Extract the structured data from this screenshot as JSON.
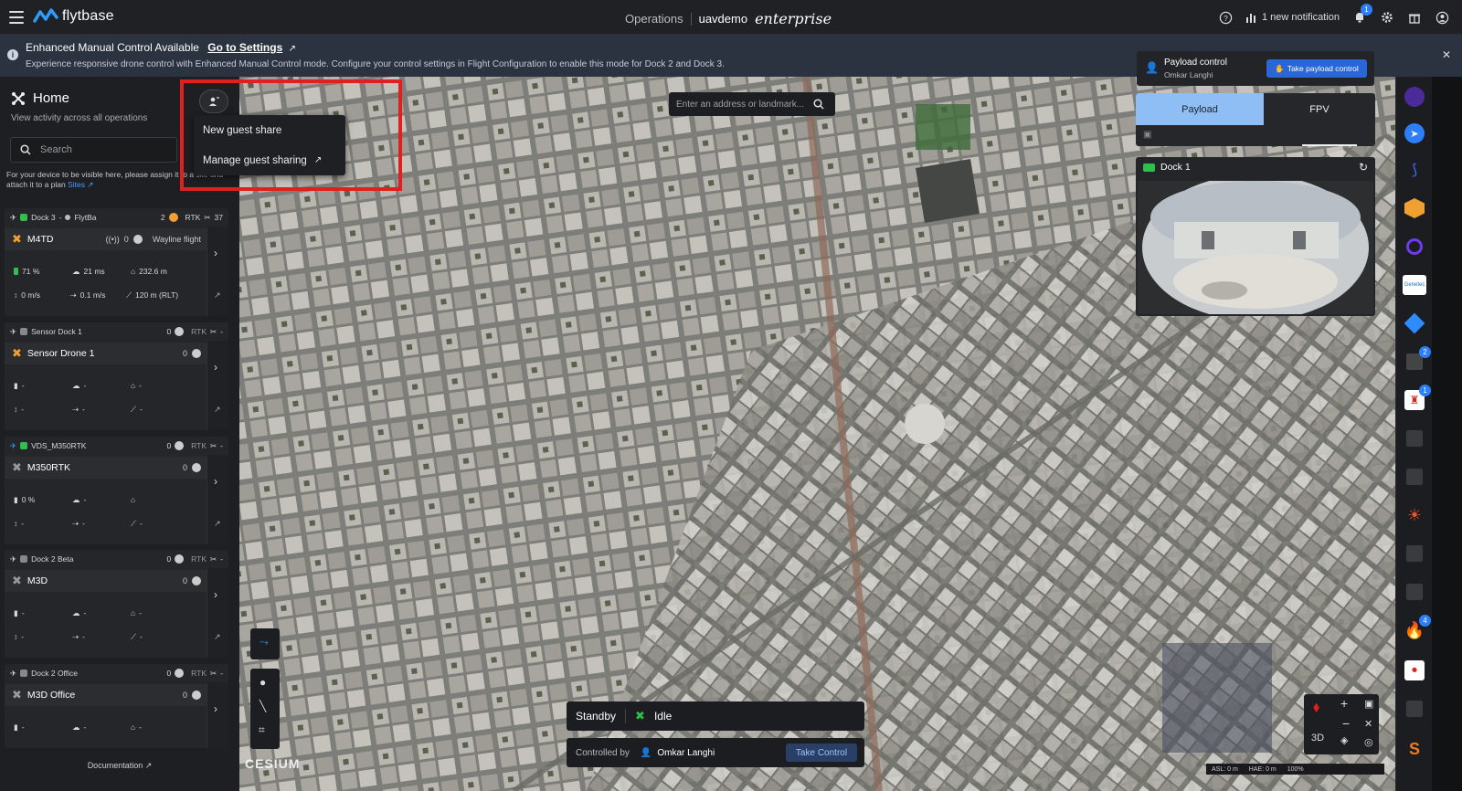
{
  "topbar": {
    "logo_text": "flytbase",
    "nav_operations": "Operations",
    "org_name": "uavdemo",
    "edition": "enterprise",
    "notification_text": "1 new notification",
    "notification_count": "1"
  },
  "banner": {
    "title": "Enhanced Manual Control Available",
    "link": "Go to Settings",
    "text": "Experience responsive drone control with Enhanced Manual Control mode. Configure your control settings in Flight Configuration to enable this mode for Dock 2 and Dock 3."
  },
  "sidebar": {
    "title": "Home",
    "subtitle": "View activity across all operations",
    "search_placeholder": "Search",
    "note_text": "For your device to be visible here, please assign it to a site and attach it to a plan",
    "note_link": "Sites",
    "documentation": "Documentation",
    "cards": [
      {
        "dock": "Dock 3",
        "dock_sub": "FlytBa",
        "count": "2",
        "rtk": "RTK",
        "sats": "37",
        "drone": "M4TD",
        "drone_count": "0",
        "mission": "Wayline flight",
        "battery": "71 %",
        "signal": "21 ms",
        "home": "232.6 m",
        "vspeed": "0 m/s",
        "hspeed": "0.1 m/s",
        "alt": "120 m (RLT)"
      },
      {
        "dock": "Sensor Dock 1",
        "count": "0",
        "rtk": "RTK",
        "sats": "-",
        "drone": "Sensor Drone 1",
        "drone_count": "0",
        "battery": "-",
        "signal": "-",
        "home": "-",
        "vspeed": "-",
        "hspeed": "-",
        "alt": "-"
      },
      {
        "dock": "VDS_M350RTK",
        "count": "0",
        "rtk": "RTK",
        "sats": "-",
        "drone": "M350RTK",
        "drone_count": "0",
        "battery": "0 %",
        "signal": "-",
        "home": "",
        "vspeed": "-",
        "hspeed": "-",
        "alt": "-"
      },
      {
        "dock": "Dock 2 Beta",
        "count": "0",
        "rtk": "RTK",
        "sats": "-",
        "drone": "M3D",
        "drone_count": "0",
        "battery": "-",
        "signal": "-",
        "home": "-",
        "vspeed": "-",
        "hspeed": "-",
        "alt": "-"
      },
      {
        "dock": "Dock 2 Office",
        "count": "0",
        "rtk": "RTK",
        "sats": "-",
        "drone": "M3D Office",
        "drone_count": "0",
        "battery": "-",
        "signal": "-",
        "home": "-"
      }
    ]
  },
  "guest_menu": {
    "item1": "New guest share",
    "item2": "Manage guest sharing"
  },
  "map": {
    "address_placeholder": "Enter an address or landmark...",
    "attribution": "CESIUM",
    "asl": "ASL: 0 m",
    "hae": "HAE: 0 m",
    "zoom": "100%",
    "view_mode": "3D"
  },
  "payload_control": {
    "title": "Payload control",
    "user": "Omkar Langhi",
    "button": "Take payload control"
  },
  "tabs": {
    "payload": "Payload",
    "fpv": "FPV"
  },
  "camera": {
    "title": "Dock 1"
  },
  "status": {
    "mode": "Standby",
    "state": "Idle",
    "controlled_label": "Controlled by",
    "controller": "Omkar Langhi",
    "take_control": "Take Control"
  },
  "rail": {
    "badge_a": "2",
    "badge_b": "1",
    "badge_c": "4",
    "genetec": "Genetec"
  },
  "colors": {
    "accent": "#2a66d6",
    "dock_green": "#2fbf4a",
    "drone_orange": "#f0a030",
    "highlight_red": "#e0201f"
  }
}
